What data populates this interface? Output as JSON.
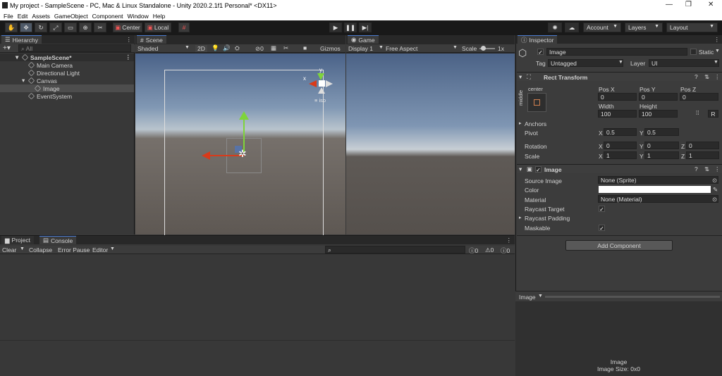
{
  "window": {
    "title": "My project - SampleScene - PC, Mac & Linux Standalone - Unity 2020.2.1f1 Personal* <DX11>",
    "minimize": "—",
    "maximize": "❐",
    "close": "✕"
  },
  "menu": [
    "File",
    "Edit",
    "Assets",
    "GameObject",
    "Component",
    "Window",
    "Help"
  ],
  "toolbar": {
    "pivot": "Center",
    "space": "Local",
    "account": "Account",
    "layers": "Layers",
    "layout": "Layout"
  },
  "hierarchy": {
    "tab": "Hierarchy",
    "search_placeholder": "All",
    "scene": "SampleScene*",
    "items": [
      "Main Camera",
      "Directional Light",
      "Canvas",
      "Image",
      "EventSystem"
    ]
  },
  "scene": {
    "tab": "Scene",
    "shading": "Shaded",
    "mode2d": "2D",
    "hidden_count": "0",
    "gizmos": "Gizmos",
    "persp_label": "iso",
    "axis_x": "x",
    "axis_y": "y"
  },
  "game": {
    "tab": "Game",
    "display": "Display 1",
    "aspect": "Free Aspect",
    "scale_label": "Scale",
    "scale_value": "1x"
  },
  "project": {
    "tab_project": "Project",
    "tab_console": "Console",
    "clear": "Clear",
    "collapse": "Collapse",
    "error_pause": "Error Pause",
    "editor": "Editor",
    "count_info": "0",
    "count_warn": "0",
    "count_err": "0"
  },
  "inspector": {
    "tab": "Inspector",
    "object_name": "Image",
    "static": "Static",
    "tag_label": "Tag",
    "tag": "Untagged",
    "layer_label": "Layer",
    "layer": "UI",
    "rect_transform": "Rect Transform",
    "anchor_h": "center",
    "anchor_v": "middle",
    "pos_x_label": "Pos X",
    "pos_y_label": "Pos Y",
    "pos_z_label": "Pos Z",
    "pos_x": "0",
    "pos_y": "0",
    "pos_z": "0",
    "width_label": "Width",
    "height_label": "Height",
    "width": "100",
    "height": "100",
    "raw_btn": "R",
    "anchors": "Anchors",
    "pivot": "Pivot",
    "pivot_x": "0.5",
    "pivot_y": "0.5",
    "rotation": "Rotation",
    "rot_x": "0",
    "rot_y": "0",
    "rot_z": "0",
    "scale": "Scale",
    "scale_x": "1",
    "scale_y": "1",
    "scale_z": "1",
    "image_comp": "Image",
    "source_image_label": "Source Image",
    "source_image": "None (Sprite)",
    "color_label": "Color",
    "material_label": "Material",
    "material": "None (Material)",
    "raycast_target": "Raycast Target",
    "raycast_padding": "Raycast Padding",
    "maskable": "Maskable",
    "add_component": "Add Component",
    "preview_dropdown": "Image",
    "preview_title": "Image",
    "preview_size": "Image Size: 0x0",
    "colors": {
      "color_swatch": "#ffffff"
    }
  }
}
